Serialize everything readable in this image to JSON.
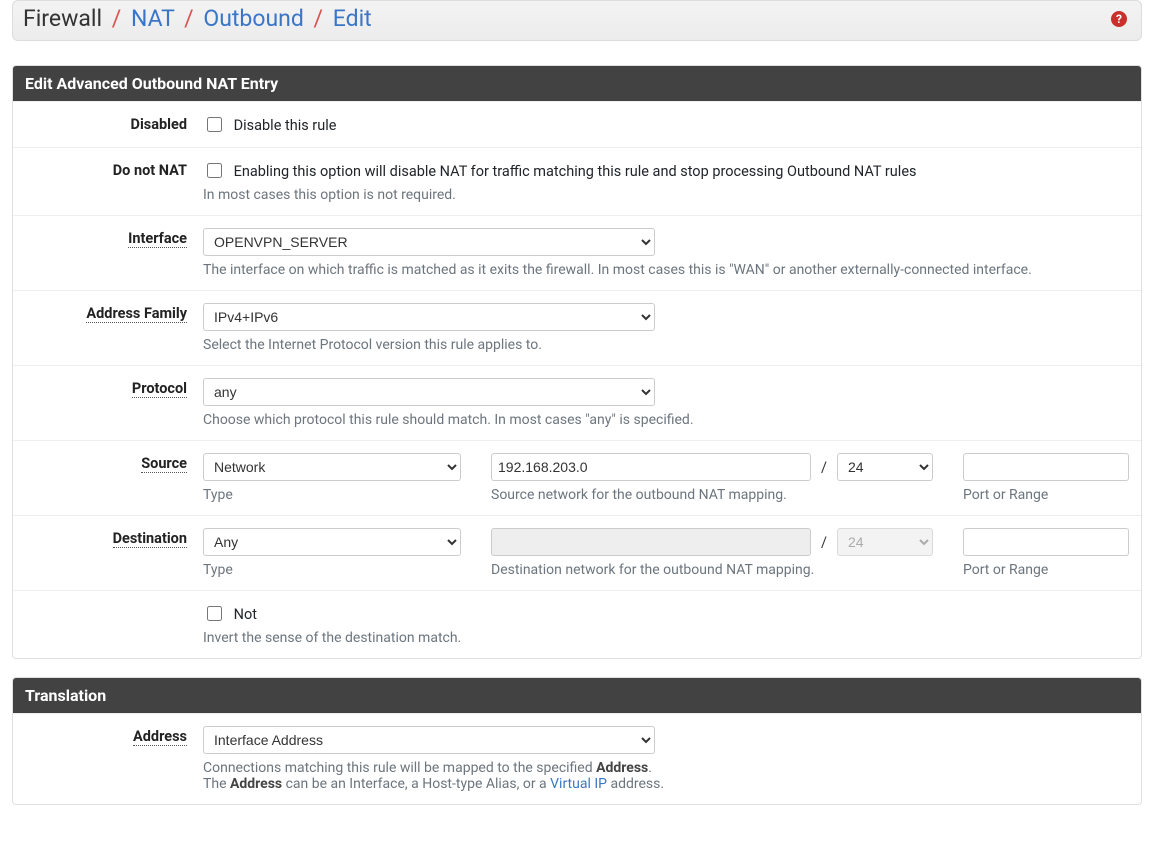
{
  "breadcrumb": {
    "root": "Firewall",
    "items": [
      "NAT",
      "Outbound",
      "Edit"
    ]
  },
  "panel1_title": "Edit Advanced Outbound NAT Entry",
  "disabled": {
    "label": "Disabled",
    "checkbox_label": "Disable this rule"
  },
  "donat": {
    "label": "Do not NAT",
    "checkbox_label": "Enabling this option will disable NAT for traffic matching this rule and stop processing Outbound NAT rules",
    "help": "In most cases this option is not required."
  },
  "interface": {
    "label": "Interface",
    "value": "OPENVPN_SERVER",
    "help": "The interface on which traffic is matched as it exits the firewall. In most cases this is \"WAN\" or another externally-connected interface."
  },
  "addrfam": {
    "label": "Address Family",
    "value": "IPv4+IPv6",
    "help": "Select the Internet Protocol version this rule applies to."
  },
  "protocol": {
    "label": "Protocol",
    "value": "any",
    "help": "Choose which protocol this rule should match. In most cases \"any\" is specified."
  },
  "source": {
    "label": "Source",
    "type_value": "Network",
    "type_caption": "Type",
    "net_value": "192.168.203.0",
    "mask_value": "24",
    "net_caption": "Source network for the outbound NAT mapping.",
    "port_caption": "Port or Range"
  },
  "destination": {
    "label": "Destination",
    "type_value": "Any",
    "type_caption": "Type",
    "net_value": "",
    "mask_value": "24",
    "net_caption": "Destination network for the outbound NAT mapping.",
    "port_caption": "Port or Range"
  },
  "notrow": {
    "checkbox_label": "Not",
    "help": "Invert the sense of the destination match."
  },
  "panel2_title": "Translation",
  "transaddr": {
    "label": "Address",
    "value": "Interface Address",
    "help_line1_a": "Connections matching this rule will be mapped to the specified ",
    "help_line1_b": "Address",
    "help_line1_c": ".",
    "help_line2_a": "The ",
    "help_line2_b": "Address",
    "help_line2_c": " can be an Interface, a Host-type Alias, or a ",
    "help_line2_link": "Virtual IP",
    "help_line2_d": " address."
  }
}
